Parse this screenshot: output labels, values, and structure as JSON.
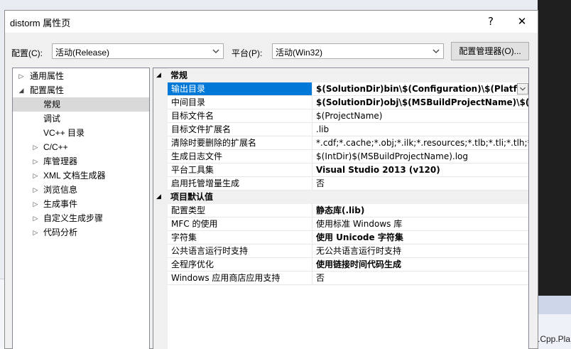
{
  "background": {
    "strip_text": ".Cpp.Pla"
  },
  "dialog": {
    "title": "distorm 属性页",
    "help_label": "?",
    "close_label": "✕",
    "config_label": "配置(C):",
    "config_value": "活动(Release)",
    "platform_label": "平台(P):",
    "platform_value": "活动(Win32)",
    "config_manager_label": "配置管理器(O)..."
  },
  "tree": {
    "items": [
      {
        "label": "通用属性",
        "twisty": "▷"
      },
      {
        "label": "配置属性",
        "twisty": "◢"
      },
      {
        "label": "常规",
        "twisty": ""
      },
      {
        "label": "调试",
        "twisty": ""
      },
      {
        "label": "VC++ 目录",
        "twisty": ""
      },
      {
        "label": "C/C++",
        "twisty": "▷"
      },
      {
        "label": "库管理器",
        "twisty": "▷"
      },
      {
        "label": "XML 文档生成器",
        "twisty": "▷"
      },
      {
        "label": "浏览信息",
        "twisty": "▷"
      },
      {
        "label": "生成事件",
        "twisty": "▷"
      },
      {
        "label": "自定义生成步骤",
        "twisty": "▷"
      },
      {
        "label": "代码分析",
        "twisty": "▷"
      }
    ]
  },
  "grid": {
    "categories": [
      {
        "label": "常规",
        "twisty": "◢",
        "rows": [
          {
            "name": "输出目录",
            "value": "$(SolutionDir)bin\\$(Configuration)\\$(Platform)\\",
            "bold": true
          },
          {
            "name": "中间目录",
            "value": "$(SolutionDir)obj\\$(MSBuildProjectName)\\$(Configuration)\\",
            "bold": true
          },
          {
            "name": "目标文件名",
            "value": "$(ProjectName)",
            "bold": false
          },
          {
            "name": "目标文件扩展名",
            "value": ".lib",
            "bold": false
          },
          {
            "name": "清除时要删除的扩展名",
            "value": "*.cdf;*.cache;*.obj;*.ilk;*.resources;*.tlb;*.tli;*.tlh;*.tmp;",
            "bold": false
          },
          {
            "name": "生成日志文件",
            "value": "$(IntDir)$(MSBuildProjectName).log",
            "bold": false
          },
          {
            "name": "平台工具集",
            "value": "Visual Studio 2013 (v120)",
            "bold": true
          },
          {
            "name": "启用托管增量生成",
            "value": "否",
            "bold": false
          }
        ]
      },
      {
        "label": "项目默认值",
        "twisty": "◢",
        "rows": [
          {
            "name": "配置类型",
            "value": "静态库(.lib)",
            "bold": true
          },
          {
            "name": "MFC 的使用",
            "value": "使用标准 Windows 库",
            "bold": false
          },
          {
            "name": "字符集",
            "value": "使用 Unicode 字符集",
            "bold": true
          },
          {
            "name": "公共语言运行时支持",
            "value": "无公共语言运行时支持",
            "bold": false
          },
          {
            "name": "全程序优化",
            "value": "使用链接时间代码生成",
            "bold": true
          },
          {
            "name": "Windows 应用商店应用支持",
            "value": "否",
            "bold": false
          }
        ]
      }
    ]
  },
  "colors": {
    "selection": "#0078d7",
    "tree_selection": "#d9d9d9"
  }
}
